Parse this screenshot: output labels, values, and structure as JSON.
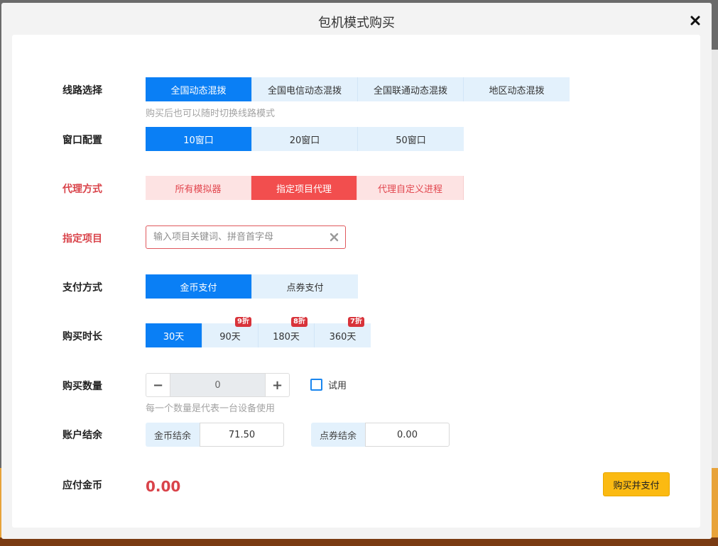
{
  "dialog": {
    "title": "包机模式购买"
  },
  "line": {
    "label": "线路选择",
    "options": [
      "全国动态混拨",
      "全国电信动态混拨",
      "全国联通动态混拨",
      "地区动态混拨"
    ],
    "selected": 0,
    "hint": "购买后也可以随时切换线路模式"
  },
  "window": {
    "label": "窗口配置",
    "options": [
      "10窗口",
      "20窗口",
      "50窗口"
    ],
    "selected": 0
  },
  "proxy": {
    "label": "代理方式",
    "options": [
      "所有模拟器",
      "指定项目代理",
      "代理自定义进程"
    ],
    "selected": 1
  },
  "project": {
    "label": "指定项目",
    "placeholder": "输入项目关键词、拼音首字母",
    "value": ""
  },
  "payment": {
    "label": "支付方式",
    "options": [
      "金币支付",
      "点券支付"
    ],
    "selected": 0
  },
  "duration": {
    "label": "购买时长",
    "options": [
      {
        "label": "30天",
        "badge": ""
      },
      {
        "label": "90天",
        "badge": "9折"
      },
      {
        "label": "180天",
        "badge": "8折"
      },
      {
        "label": "360天",
        "badge": "7折"
      }
    ],
    "selected": 0
  },
  "quantity": {
    "label": "购买数量",
    "minus": "−",
    "plus": "+",
    "value": "0",
    "trial_label": "试用",
    "hint": "每一个数量是代表一台设备使用"
  },
  "balance": {
    "label": "账户结余",
    "coin_label": "金币结余",
    "coin_value": "71.50",
    "voucher_label": "点券结余",
    "voucher_value": "0.00"
  },
  "due": {
    "label": "应付金币",
    "amount": "0.00",
    "pay_button": "购买并支付"
  },
  "colors": {
    "primary": "#0a7ff5",
    "danger": "#f24e4e",
    "accent_button": "#fbba12"
  }
}
